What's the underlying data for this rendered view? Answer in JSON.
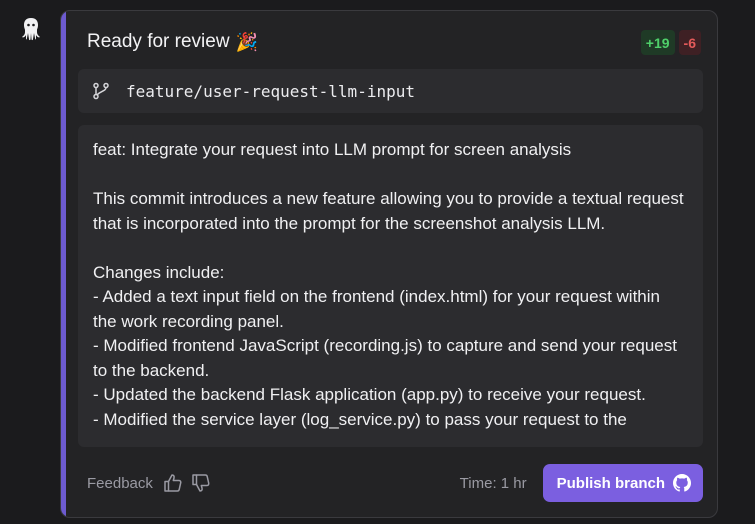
{
  "app": {
    "avatar_icon": "octopus-icon"
  },
  "card": {
    "title": "Ready for review",
    "title_emoji": "🎉",
    "diff": {
      "additions": "+19",
      "deletions": "-6"
    },
    "branch": {
      "icon": "git-branch-icon",
      "name": "feature/user-request-llm-input"
    },
    "commit_message": {
      "line1": "feat: Integrate your request into LLM prompt for screen analysis",
      "line2": "This commit introduces a new feature allowing you to provide a textual request that is incorporated into the prompt for the screenshot analysis LLM.",
      "line3": "Changes include:",
      "line4": "- Added a text input field on the frontend (index.html) for your request within the work recording panel.",
      "line5": "- Modified frontend JavaScript (recording.js) to capture and send your request to the backend.",
      "line6": "- Updated the backend Flask application (app.py) to receive your request.",
      "line7": "- Modified the service layer (log_service.py) to pass your request to the"
    },
    "footer": {
      "feedback_label": "Feedback",
      "thumbs_up_icon": "thumbs-up-icon",
      "thumbs_down_icon": "thumbs-down-icon",
      "time_label": "Time: 1 hr",
      "publish_label": "Publish branch",
      "publish_icon": "github-icon"
    }
  },
  "colors": {
    "accent": "#6d5bd0",
    "button": "#7b5fe0",
    "additions": "#4fd06a",
    "deletions": "#e35a5a",
    "background": "#1b1b1d",
    "card": "#232325",
    "panel": "#2c2c2f"
  }
}
